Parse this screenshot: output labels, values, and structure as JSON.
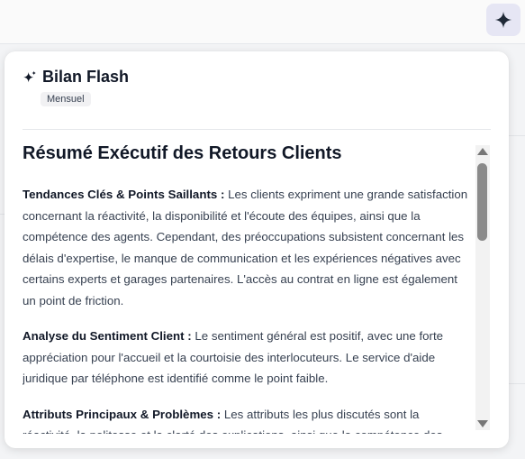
{
  "icons": {
    "assistant": "sparkle-icon",
    "title": "sparkles-icon"
  },
  "colors": {
    "accent_button_bg": "#e6e6f4",
    "card_bg": "#ffffff",
    "text": "#374151"
  },
  "card": {
    "title": "Bilan Flash",
    "badge": "Mensuel"
  },
  "summary": {
    "heading": "Résumé Exécutif des Retours Clients",
    "sections": [
      {
        "label": "Tendances Clés & Points Saillants :",
        "text": " Les clients expriment une grande satisfaction concernant la réactivité, la disponibilité et l'écoute des équipes, ainsi que la compétence des agents. Cependant, des préoccupations subsistent concernant les délais d'expertise, le manque de communication et les expériences négatives avec certains experts et garages partenaires. L'accès au contrat en ligne est également un point de friction."
      },
      {
        "label": "Analyse du Sentiment Client :",
        "text": " Le sentiment général est positif, avec une forte appréciation pour l'accueil et la courtoisie des interlocuteurs. Le service d'aide juridique par téléphone est identifié comme le point faible."
      },
      {
        "label": "Attributs Principaux & Problèmes :",
        "text": " Les attributs les plus discutés sont la réactivité, la politesse et la clarté des explications, ainsi que la compétence des agents."
      }
    ]
  },
  "scroll": {
    "position_fraction": 0.0
  }
}
